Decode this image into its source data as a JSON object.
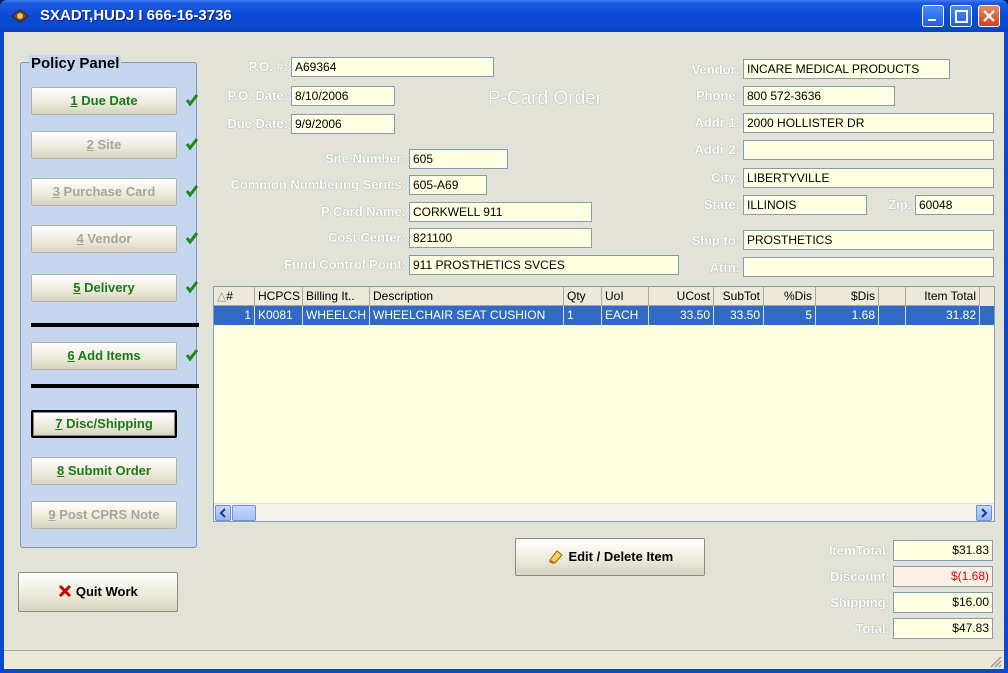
{
  "window": {
    "title": "SXADT,HUDJ I 666-16-3736"
  },
  "policy_panel": {
    "title": "Policy Panel",
    "buttons": [
      {
        "num": "1",
        "label": "Due Date",
        "state": "enabled",
        "checked": true
      },
      {
        "num": "2",
        "label": "Site",
        "state": "disabled",
        "checked": true
      },
      {
        "num": "3",
        "label": "Purchase Card",
        "state": "disabled",
        "checked": true
      },
      {
        "num": "4",
        "label": "Vendor",
        "state": "disabled",
        "checked": true
      },
      {
        "num": "5",
        "label": "Delivery",
        "state": "enabled",
        "checked": true
      },
      {
        "num": "6",
        "label": "Add Items",
        "state": "enabled",
        "checked": true
      },
      {
        "num": "7",
        "label": "Disc/Shipping",
        "state": "active",
        "checked": false
      },
      {
        "num": "8",
        "label": "Submit Order",
        "state": "enabled",
        "checked": false
      },
      {
        "num": "9",
        "label": "Post CPRS Note",
        "state": "disabled",
        "checked": false
      }
    ]
  },
  "quit": {
    "label": "Quit Work",
    "accel": "Q"
  },
  "order": {
    "heading": "P-Card Order",
    "po_num_label": "P.O. #:",
    "po_num": "A69364",
    "po_date_label": "P.O. Date:",
    "po_date": "8/10/2006",
    "due_date_label": "Due Date:",
    "due_date": "9/9/2006",
    "site_number_label": "Site Number:",
    "site_number": "605",
    "common_numbering_label": "Common Numbering Series:",
    "common_numbering": "605-A69",
    "pcard_name_label": "P Card Name:",
    "pcard_name": "CORKWELL 911",
    "cost_center_label": "Cost Center:",
    "cost_center": "821100",
    "fund_control_label": "Fund Control Point:",
    "fund_control": "911 PROSTHETICS SVCES"
  },
  "vendor": {
    "vendor_label": "Vendor:",
    "vendor": "INCARE MEDICAL PRODUCTS",
    "phone_label": "Phone:",
    "phone": "800 572-3636",
    "addr1_label": "Addr 1:",
    "addr1": "2000 HOLLISTER DR",
    "addr2_label": "Addr 2:",
    "addr2": "",
    "city_label": "City:",
    "city": "LIBERTYVILLE",
    "state_label": "State:",
    "state": "ILLINOIS",
    "zip_label": "Zip:",
    "zip": "60048",
    "ship_to_label": "Ship to:",
    "ship_to": "PROSTHETICS",
    "attn_label": "Attn:",
    "attn": ""
  },
  "items_grid": {
    "columns": [
      "#",
      "HCPCS",
      "Billing It..",
      "Description",
      "Qty",
      "UoI",
      "UCost",
      "SubTot",
      "%Dis",
      "$Dis",
      "",
      "Item Total"
    ],
    "rows": [
      [
        "1",
        "K0081",
        "WHEELCH",
        "WHEELCHAIR SEAT CUSHION",
        "1",
        "EACH",
        "33.50",
        "33.50",
        "5",
        "1.68",
        "",
        "31.82"
      ]
    ]
  },
  "edit_button": {
    "label": "Edit / Delete Item",
    "accel": "E"
  },
  "totals": {
    "item_total_label": "ItemTotal:",
    "item_total": "$31.83",
    "discount_label": "Discount:",
    "discount": "$(1.68)",
    "shipping_label": "Shipping:",
    "shipping": "$16.00",
    "total_label": "Total:",
    "total": "$47.83"
  },
  "colors": {
    "accent_green": "#1a7a1a",
    "selection": "#316ac5",
    "field_bg": "#ffffe1",
    "negative": "#e00000"
  }
}
